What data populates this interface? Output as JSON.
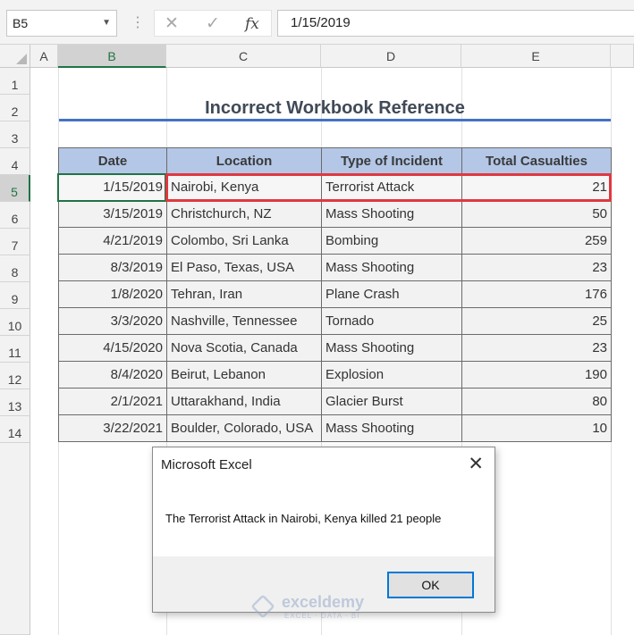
{
  "formula_bar": {
    "name_box": "B5",
    "cancel_icon": "✕",
    "enter_icon": "✓",
    "fx_label": "fx",
    "formula_value": "1/15/2019"
  },
  "columns": [
    "A",
    "B",
    "C",
    "D",
    "E"
  ],
  "active_column": "B",
  "rows": [
    "1",
    "2",
    "3",
    "4",
    "5",
    "6",
    "7",
    "8",
    "9",
    "10",
    "11",
    "12",
    "13",
    "14"
  ],
  "active_row": "5",
  "sheet": {
    "title": "Incorrect Workbook Reference",
    "table": {
      "headers": [
        "Date",
        "Location",
        "Type of Incident",
        "Total Casualties"
      ],
      "rows": [
        [
          "1/15/2019",
          "Nairobi, Kenya",
          "Terrorist Attack",
          "21"
        ],
        [
          "3/15/2019",
          "Christchurch, NZ",
          "Mass Shooting",
          "50"
        ],
        [
          "4/21/2019",
          "Colombo, Sri Lanka",
          "Bombing",
          "259"
        ],
        [
          "8/3/2019",
          "El Paso, Texas, USA",
          "Mass Shooting",
          "23"
        ],
        [
          "1/8/2020",
          "Tehran, Iran",
          "Plane Crash",
          "176"
        ],
        [
          "3/3/2020",
          "Nashville, Tennessee",
          "Tornado",
          "25"
        ],
        [
          "4/15/2020",
          "Nova Scotia, Canada",
          "Mass Shooting",
          "23"
        ],
        [
          "8/4/2020",
          "Beirut, Lebanon",
          "Explosion",
          "190"
        ],
        [
          "2/1/2021",
          "Uttarakhand, India",
          "Glacier Burst",
          "80"
        ],
        [
          "3/22/2021",
          "Boulder, Colorado, USA",
          "Mass Shooting",
          "10"
        ]
      ]
    }
  },
  "dialog": {
    "title": "Microsoft Excel",
    "message": "The Terrorist Attack in Nairobi, Kenya killed 21 people",
    "ok_label": "OK",
    "close_icon": "✕"
  },
  "watermark": {
    "name": "exceldemy",
    "tagline": "EXCEL · DATA · BI"
  },
  "colors": {
    "header_fill": "#b4c7e7",
    "title_rule": "#4472c4",
    "highlight": "#e0383f",
    "active_cell": "#217346"
  }
}
